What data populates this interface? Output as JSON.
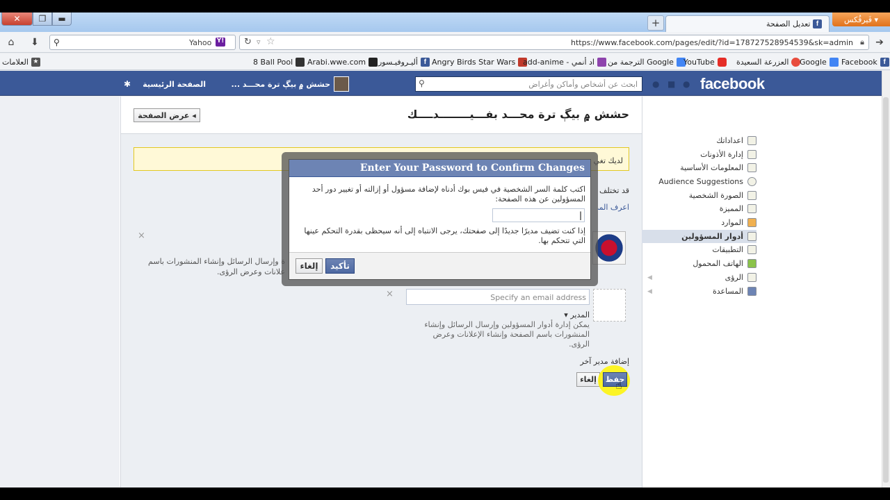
{
  "browser": {
    "menu_label": "فَيرفُكس",
    "tab_title": "تعديل الصفحة",
    "new_tab_symbol": "+",
    "search_engine": "Yahoo",
    "url": "https://www.facebook.com/pages/edit/?id=178727528954539&sk=admin",
    "bookmarks": [
      "Facebook",
      "Google",
      "العزرعة السعيدة",
      "YouTube",
      "الترجمة من Google",
      "add-anime - اد أنمي",
      "Angry Birds Star Wars",
      "أليـروفيـسور",
      "Arabi.wwe.com",
      "8 Ball Pool"
    ],
    "bookmarks_menu": "العلامات"
  },
  "fb": {
    "logo": "facebook",
    "search_placeholder": "ابحث عن أشخاص وأماكن وأغراض",
    "home_link": "الصفحة الرئيسية",
    "page_short_name": "حشش ۾ بيڳ ترة محـــد ..."
  },
  "page": {
    "title": "حشش ۾ بيڳ ترة محـــد بفـــيــــــــدــــك",
    "view_page_button": "عرض الصفحة",
    "notice_partial": "لديك تغي",
    "side_text_1": "قد تختلف",
    "side_text_2": "اعرف المزي",
    "admin_desc_partial": "ة وإرسال الرسائل وإنشاء المنشورات باسم",
    "admin_desc_partial2": "علانات وعرض الرؤى.",
    "email_placeholder": "Specify an email address",
    "role_label": "المدير",
    "role_desc": "يمكن إدارة أدوار المسؤولين وإرسال الرسائل وإنشاء المنشورات باسم الصفحة وإنشاء الإعلانات وعرض الرؤى.",
    "add_admin_link": "إضافة مدير آخر",
    "save_button": "حفظ",
    "cancel_button": "إلغاء"
  },
  "sidebar": {
    "items": [
      {
        "label": "اعداداتك",
        "active": false
      },
      {
        "label": "إدارة الأذونات",
        "active": false
      },
      {
        "label": "المعلومات الأساسية",
        "active": false
      },
      {
        "label": "Audience Suggestions",
        "active": false
      },
      {
        "label": "الصورة الشخصية",
        "active": false
      },
      {
        "label": "المميزة",
        "active": false
      },
      {
        "label": "الموارد",
        "active": false
      },
      {
        "label": "أدوار المسؤولين",
        "active": true
      },
      {
        "label": "التطبيقات",
        "active": false
      },
      {
        "label": "الهاتف المحمول",
        "active": false
      },
      {
        "label": "الرؤى",
        "active": false
      },
      {
        "label": "المساعدة",
        "active": false
      }
    ]
  },
  "dialog": {
    "title": "Enter Your Password to Confirm Changes",
    "instruction": "اكتب كلمة السر الشخصية في فيس بوك أدناه لإضافة مسؤول أو إزالته أو تغيير دور أحد المسؤولين عن هذه الصفحة:",
    "warning": "إذا كنت تضيف مديرًا جديدًا إلى صفحتك، يرجى الانتباه إلى أنه سيحظى بقدرة التحكم عينها التي تتحكم بها.",
    "confirm_button": "تأكيد",
    "cancel_button": "إلغاء"
  },
  "colors": {
    "fb_blue": "#3b5998",
    "firefox_orange": "#e2721b"
  }
}
